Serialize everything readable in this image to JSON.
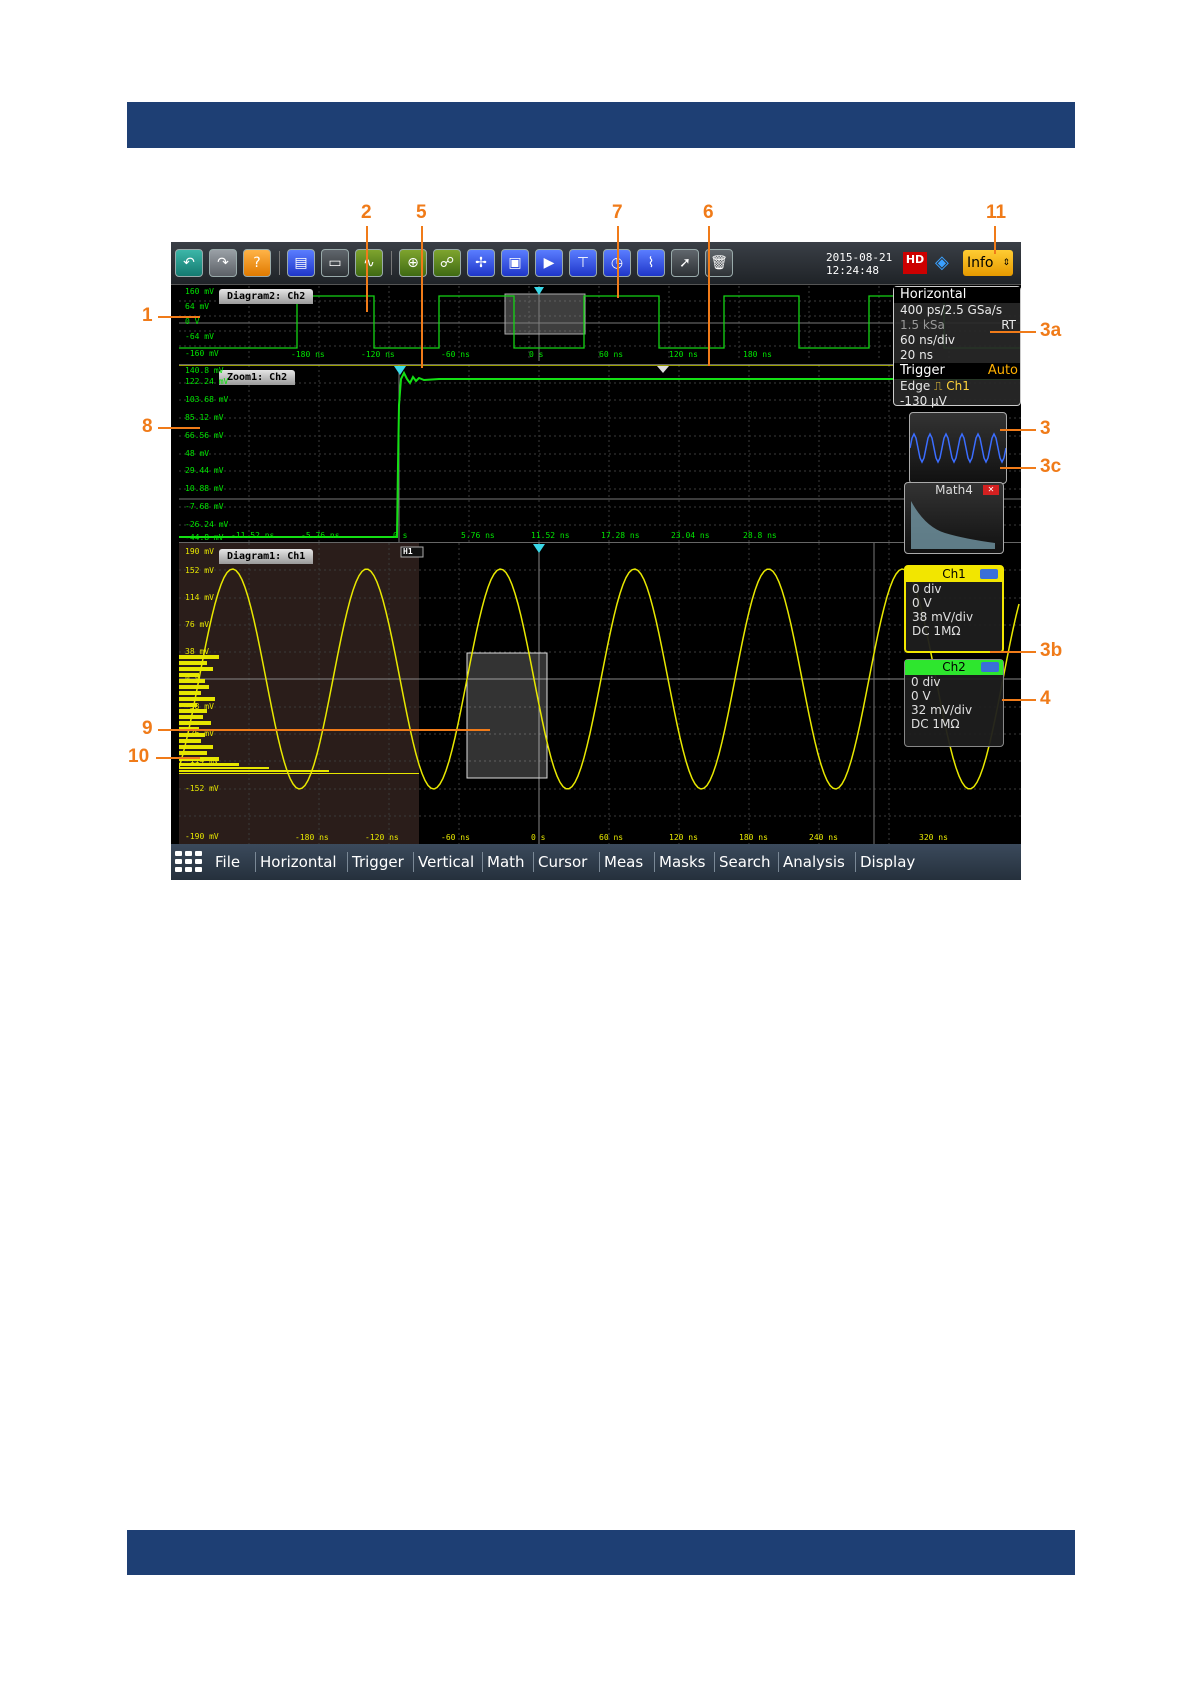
{
  "toolbar": {
    "date": "2015-08-21",
    "time": "12:24:48",
    "hd_badge": "HD",
    "info_label": "Info",
    "icons": [
      "undo-icon",
      "redo-icon",
      "help-icon",
      "save-setup-icon",
      "open-folder-icon",
      "autoset-icon",
      "zoom-icon",
      "binoculars-icon",
      "signal-config-icon",
      "memory-icon",
      "marker-icon",
      "cursor-icon",
      "timer-icon",
      "measure-icon",
      "pointer-icon",
      "delete-icon"
    ]
  },
  "diagram2": {
    "tab": "Diagram2: Ch2",
    "y_labels": [
      "160 mV",
      "64 mV",
      "0 V",
      "-64 mV",
      "-160 mV"
    ],
    "x_labels": [
      "-180 ns",
      "-120 ns",
      "-60 ns",
      "0 s",
      "60 ns",
      "120 ns",
      "180 ns"
    ],
    "color": "#00e600"
  },
  "zoom1": {
    "tab": "Zoom1: Ch2",
    "y_labels": [
      "140.8 mV",
      "122.24 mV",
      "103.68 mV",
      "85.12 mV",
      "66.56 mV",
      "48 mV",
      "29.44 mV",
      "10.88 mV",
      "-7.68 mV",
      "-26.24 mV",
      "-44.8 mV"
    ],
    "x_labels": [
      "-11.52 ns",
      "-5.76 ns",
      "0 s",
      "5.76 ns",
      "11.52 ns",
      "17.28 ns",
      "23.04 ns",
      "28.8 ns"
    ],
    "color": "#00e600"
  },
  "diagram1": {
    "tab": "Diagram1: Ch1",
    "histogram_tag": "H1",
    "y_labels": [
      "190 mV",
      "152 mV",
      "114 mV",
      "76 mV",
      "38 mV",
      "0 V",
      "-38 mV",
      "-76 mV",
      "-114 mV",
      "-152 mV",
      "-190 mV"
    ],
    "x_labels": [
      "-180 ns",
      "-120 ns",
      "-60 ns",
      "0 s",
      "60 ns",
      "120 ns",
      "180 ns",
      "240 ns",
      "320 ns"
    ],
    "color": "#e8e800"
  },
  "info_panel": {
    "horizontal_title": "Horizontal",
    "resolution": "400 ps/2.5 GSa/s",
    "record_length": "1.5 kSa",
    "mode": "RT",
    "time_scale": "60 ns/div",
    "position": "20 ns",
    "trigger_title": "Trigger",
    "trigger_mode": "Auto",
    "trigger_type": "Edge",
    "trigger_source": "Ch1",
    "trigger_level": "-130 µV"
  },
  "math_icon": {
    "label": "Math4"
  },
  "channels": [
    {
      "name": "Ch1",
      "offset": "0 div",
      "position": "0 V",
      "scale": "38 mV/div",
      "coupling": "DC 1MΩ",
      "color": "#f2e600"
    },
    {
      "name": "Ch2",
      "offset": "0 div",
      "position": "0 V",
      "scale": "32 mV/div",
      "coupling": "DC 1MΩ",
      "color": "#2ee62e"
    }
  ],
  "menu": [
    "File",
    "Horizontal",
    "Trigger",
    "Vertical",
    "Math",
    "Cursor",
    "Meas",
    "Masks",
    "Search",
    "Analysis",
    "Display"
  ],
  "callouts": {
    "c1": "1",
    "c2": "2",
    "c3": "3",
    "c3a": "3a",
    "c3b": "3b",
    "c3c": "3c",
    "c4": "4",
    "c5": "5",
    "c6": "6",
    "c7": "7",
    "c8": "8",
    "c9": "9",
    "c10": "10",
    "c11": "11"
  }
}
